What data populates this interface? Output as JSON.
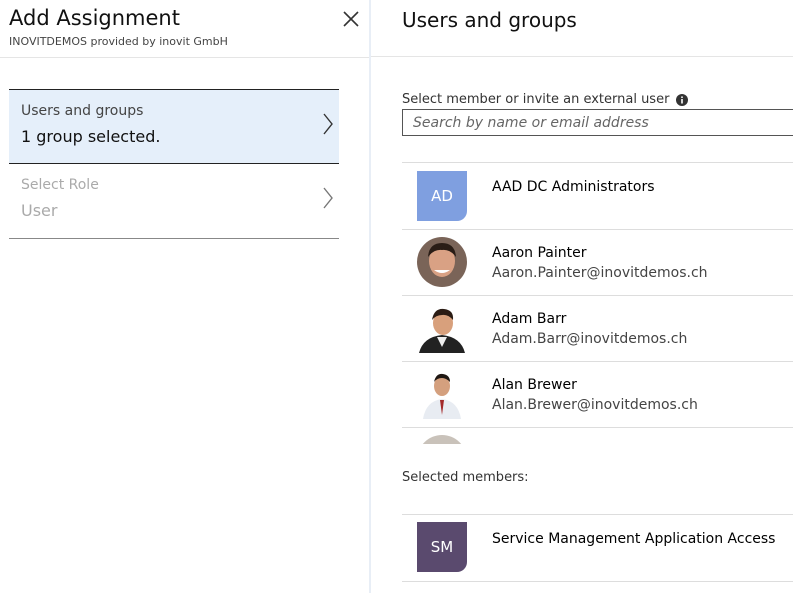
{
  "left_panel": {
    "title": "Add Assignment",
    "subtitle": "INOVITDEMOS provided by inovit GmbH",
    "close_icon": "close-icon",
    "steps": [
      {
        "label": "Users and groups",
        "value": "1 group selected.",
        "state": "active"
      },
      {
        "label": "Select Role",
        "value": "User",
        "state": "disabled"
      }
    ]
  },
  "right_panel": {
    "title": "Users and groups",
    "search": {
      "label": "Select member or invite an external user",
      "placeholder": "Search by name or email address",
      "info_icon": "info-icon"
    },
    "members": [
      {
        "initials": "AD",
        "name": "AAD DC Administrators",
        "email": "",
        "avatar_color": "#7f9fe0"
      },
      {
        "initials": "",
        "name": "Aaron Painter",
        "email": "Aaron.Painter@inovitdemos.ch",
        "avatar_type": "photo"
      },
      {
        "initials": "",
        "name": "Adam Barr",
        "email": "Adam.Barr@inovitdemos.ch",
        "avatar_type": "photo"
      },
      {
        "initials": "",
        "name": "Alan Brewer",
        "email": "Alan.Brewer@inovitdemos.ch",
        "avatar_type": "photo"
      }
    ],
    "selected_label": "Selected members:",
    "selected": [
      {
        "initials": "SM",
        "name": "Service Management Application Access",
        "avatar_color": "#5a4a6e"
      }
    ]
  }
}
